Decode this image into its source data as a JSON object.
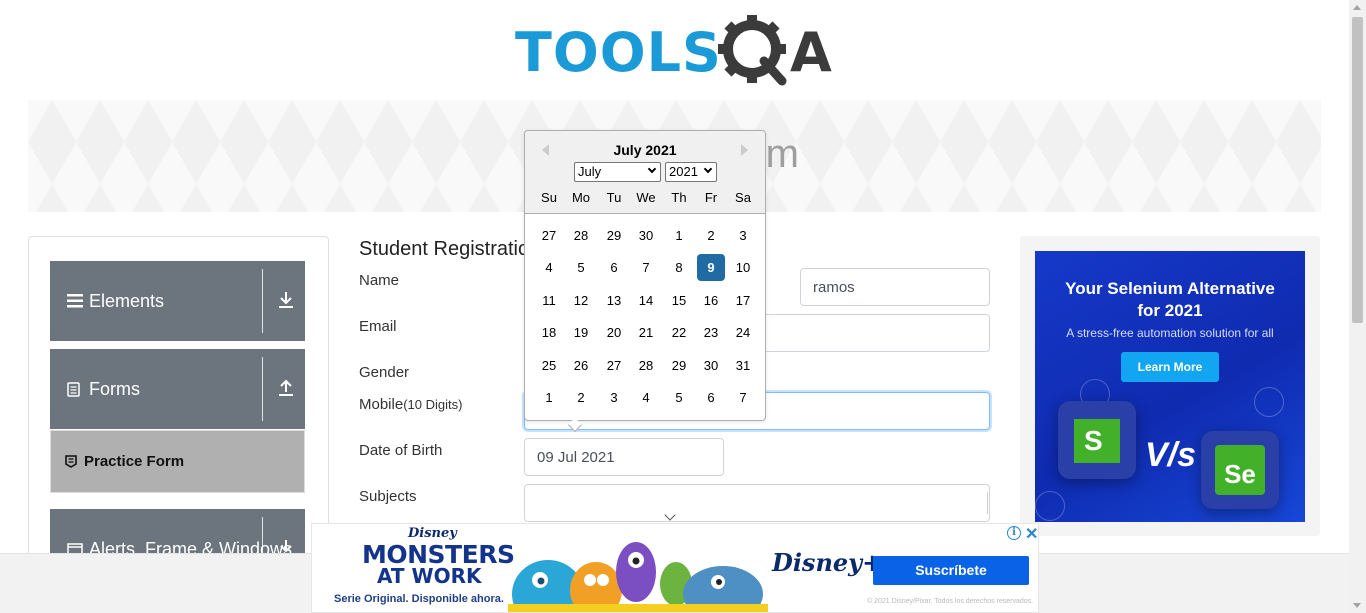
{
  "header": {
    "logo_main": "TOOLS",
    "logo_suffix": "A"
  },
  "banner": {
    "title": "Practice Form"
  },
  "sidebar": {
    "groups": [
      {
        "label": "Elements",
        "icon": "hamburger-icon",
        "arrow": "download-arrow-icon"
      },
      {
        "label": "Forms",
        "icon": "document-icon",
        "arrow": "upload-arrow-icon"
      },
      {
        "label": "Alerts, Frame & Windows",
        "icon": "window-icon",
        "arrow": "download-arrow-icon"
      }
    ],
    "active_item": {
      "label": "Practice Form",
      "icon": "form-icon"
    }
  },
  "form": {
    "title": "Student Registration Form",
    "name_label": "Name",
    "last_name_value": "ramos",
    "email_label": "Email",
    "gender_label": "Gender",
    "mobile_label": "Mobile",
    "mobile_hint": "(10 Digits)",
    "dob_label": "Date of Birth",
    "dob_value": "09 Jul 2021",
    "subjects_label": "Subjects"
  },
  "datepicker": {
    "title": "July 2021",
    "month_selected": "July",
    "year_selected": "2021",
    "weekdays": [
      "Su",
      "Mo",
      "Tu",
      "We",
      "Th",
      "Fr",
      "Sa"
    ],
    "weeks": [
      [
        "27",
        "28",
        "29",
        "30",
        "1",
        "2",
        "3"
      ],
      [
        "4",
        "5",
        "6",
        "7",
        "8",
        "9",
        "10"
      ],
      [
        "11",
        "12",
        "13",
        "14",
        "15",
        "16",
        "17"
      ],
      [
        "18",
        "19",
        "20",
        "21",
        "22",
        "23",
        "24"
      ],
      [
        "25",
        "26",
        "27",
        "28",
        "29",
        "30",
        "31"
      ],
      [
        "1",
        "2",
        "3",
        "4",
        "5",
        "6",
        "7"
      ]
    ],
    "selected_day": "9",
    "selected_color": "#216ba5"
  },
  "right_ad": {
    "title_line1": "Your Selenium Alternative",
    "title_line2": "for 2021",
    "subtitle": "A stress-free automation solution for all",
    "button": "Learn More",
    "logo_left": "S",
    "vs": "V/s",
    "logo_right": "Se"
  },
  "bottom_ad": {
    "brand_small": "Disney",
    "title_line1": "MONSTERS",
    "title_line2": "AT WORK",
    "tagline": "Serie Original. Disponible ahora.",
    "service": "Disney+",
    "button": "Suscríbete",
    "copyright": "© 2021 Disney/Pixar. Todos los derechos reservados.",
    "close": "✕",
    "adchoice": "i"
  },
  "colors": {
    "accent": "#1a9ad6",
    "sidebar_group": "#6c757d",
    "sidebar_active": "#b0b0b0",
    "ad_button": "#0a63e6"
  }
}
